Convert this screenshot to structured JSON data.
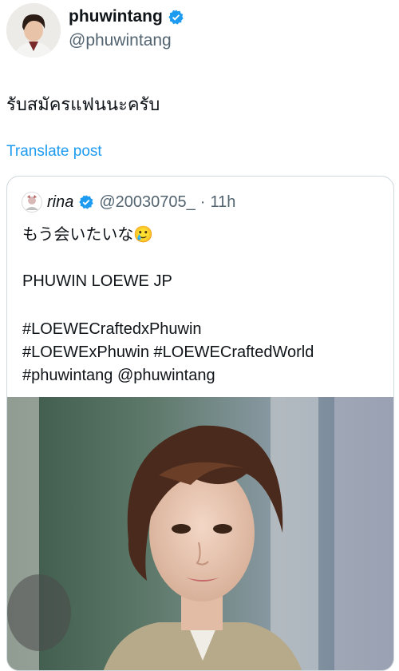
{
  "author": {
    "name": "phuwintang",
    "handle": "@phuwintang",
    "avatar_icon": "profile-photo"
  },
  "post": {
    "text": "รับสมัครแฟนนะครับ",
    "translate_label": "Translate post"
  },
  "quote": {
    "name": "rina",
    "handle": "@20030705_",
    "separator": "·",
    "time": "11h",
    "lines": [
      "もう会いたいな🥲",
      "PHUWIN LOEWE JP",
      "#LOEWECraftedxPhuwin",
      "#LOEWExPhuwin #LOEWECraftedWorld",
      "#phuwintang @phuwintang"
    ],
    "image_icon": "portrait-photo"
  },
  "colors": {
    "accent": "#1d9bf0",
    "muted": "#536471",
    "text": "#0f1419",
    "border": "#cfd9de"
  }
}
